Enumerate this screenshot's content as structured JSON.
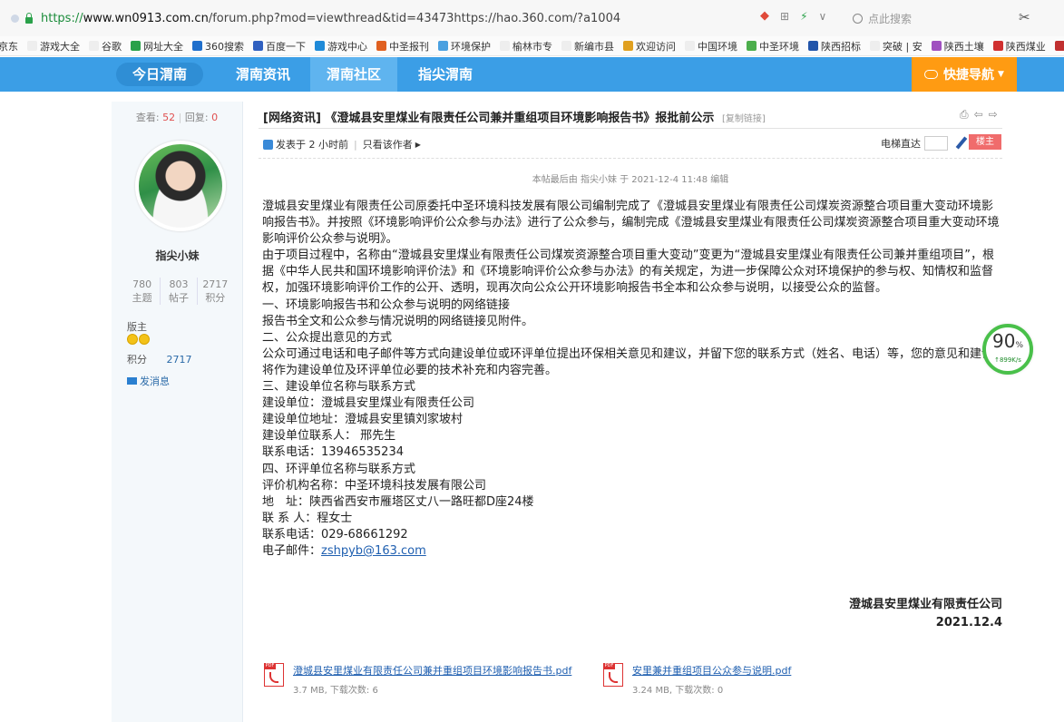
{
  "browser": {
    "url_scheme": "https://",
    "url_host": "www.wn0913.com.cn",
    "url_rest": "/forum.php?mod=viewthread&tid=43473https://hao.360.com/?a1004",
    "search_placeholder": "点此搜索",
    "controls": [
      "⊞",
      "⚡",
      "∨"
    ]
  },
  "bookmarks": [
    "京东",
    "游戏大全",
    "谷歌",
    "网址大全",
    "360搜索",
    "百度一下",
    "游戏中心",
    "中圣报刊",
    "环境保护",
    "榆林市专",
    "新编市县",
    "欢迎访问",
    "中国环境",
    "中圣环境",
    "陕西招标",
    "突破 | 安",
    "陕西土壤",
    "陕西煤业",
    "焊"
  ],
  "nav": {
    "items": [
      "今日渭南",
      "渭南资讯",
      "渭南社区",
      "指尖渭南"
    ],
    "active": "渭南社区",
    "quick": "快捷导航"
  },
  "sidebar": {
    "views_label": "查看:",
    "views": "52",
    "replies_label": "回复:",
    "replies": "0",
    "username": "指尖小妹",
    "counts": [
      {
        "value": "780",
        "label": "主题"
      },
      {
        "value": "803",
        "label": "帖子"
      },
      {
        "value": "2717",
        "label": "积分"
      }
    ],
    "rank": "版主",
    "score_label": "积分",
    "score_value": "2717",
    "message": "发消息"
  },
  "thread": {
    "category": "[网络资讯]",
    "title": "《澄城县安里煤业有限责任公司兼并重组项目环境影响报告书》报批前公示",
    "copy_link": "[复制链接]",
    "posted": "发表于 2 小时前",
    "only_author": "只看该作者",
    "elevator": "电梯直达",
    "floor": "楼主",
    "edited": "本帖最后由 指尖小妹 于 2021-12-4 11:48 编辑"
  },
  "content": {
    "lines": [
      "澄城县安里煤业有限责任公司原委托中圣环境科技发展有限公司编制完成了《澄城县安里煤业有限责任公司煤炭资源整合项目重大变动环境影响报告书》。并按照《环境影响评价公众参与办法》进行了公众参与，编制完成《澄城县安里煤业有限责任公司煤炭资源整合项目重大变动环境影响评价公众参与说明》。",
      "由于项目过程中，名称由“澄城县安里煤业有限责任公司煤炭资源整合项目重大变动”变更为“澄城县安里煤业有限责任公司兼并重组项目”，根据《中华人民共和国环境影响评价法》和《环境影响评价公众参与办法》的有关规定，为进一步保障公众对环境保护的参与权、知情权和监督权，加强环境影响评价工作的公开、透明，现再次向公众公开环境影响报告书全本和公众参与说明，以接受公众的监督。",
      "一、环境影响报告书和公众参与说明的网络链接",
      "报告书全文和公众参与情况说明的网络链接见附件。",
      "二、公众提出意见的方式",
      "公众可通过电话和电子邮件等方式向建设单位或环评单位提出环保相关意见和建议，并留下您的联系方式（姓名、电话）等，您的意见和建议将作为建设单位及环评单位必要的技术补充和内容完善。",
      "三、建设单位名称与联系方式",
      "建设单位：澄城县安里煤业有限责任公司",
      "建设单位地址：澄城县安里镇刘家坡村",
      "建设单位联系人： 邢先生",
      "联系电话：13946535234",
      "四、环评单位名称与联系方式",
      "评价机构名称：中圣环境科技发展有限公司",
      "地　址：陕西省西安市雁塔区丈八一路旺都D座24楼",
      "联 系 人：程女士",
      "联系电话：029-68661292"
    ],
    "email_label": "电子邮件：",
    "email": "zshpyb@163.com",
    "sign_company": "澄城县安里煤业有限责任公司",
    "sign_date": "2021.12.4"
  },
  "attachments": [
    {
      "name": "澄城县安里煤业有限责任公司兼并重组项目环境影响报告书.pdf",
      "meta": "3.7 MB, 下载次数: 6"
    },
    {
      "name": "安里兼并重组项目公众参与说明.pdf",
      "meta": "3.24 MB, 下载次数: 0"
    }
  ],
  "speed_widget": {
    "percent": "90",
    "unit": "%",
    "rate": "↑899K/s"
  },
  "colors": {
    "nav": "#3b9ee6",
    "quick": "#ff9b12",
    "floor": "#f06c6c",
    "speed": "#49c04a"
  }
}
